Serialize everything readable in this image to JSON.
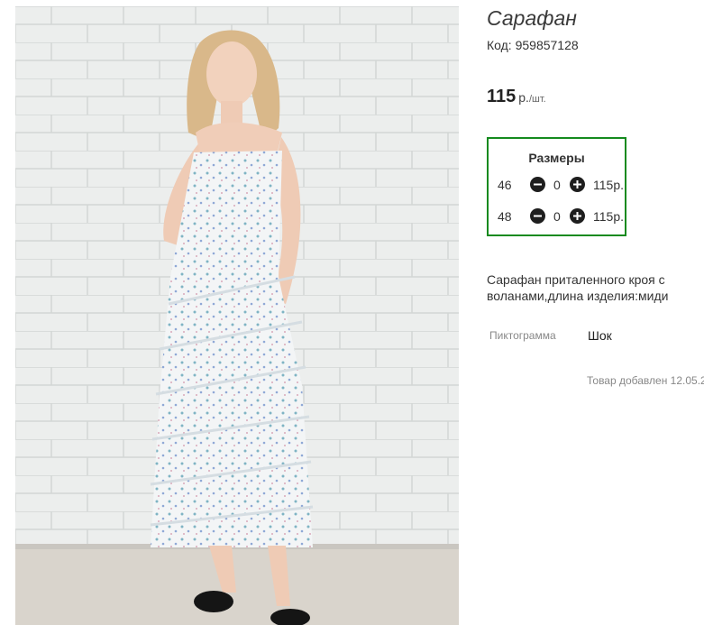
{
  "product": {
    "title": "Сарафан",
    "code": "Код: 959857128",
    "price_value": "115",
    "price_currency": "р.",
    "price_unit": "/шт.",
    "image_alt": "Сарафан"
  },
  "sizes": {
    "title": "Размеры",
    "rows": [
      {
        "size": "46",
        "qty": "0",
        "price": "115р."
      },
      {
        "size": "48",
        "qty": "0",
        "price": "115р."
      }
    ]
  },
  "description": "Сарафан приталенного кроя с воланами,длина изделия:миди",
  "attributes": [
    {
      "name": "Пиктограмма",
      "value": "Шок"
    }
  ],
  "added_date": "Товар добавлен 12.05.2",
  "colors": {
    "sizes_border": "#148a1e",
    "buttons": "#1e1e1e"
  }
}
